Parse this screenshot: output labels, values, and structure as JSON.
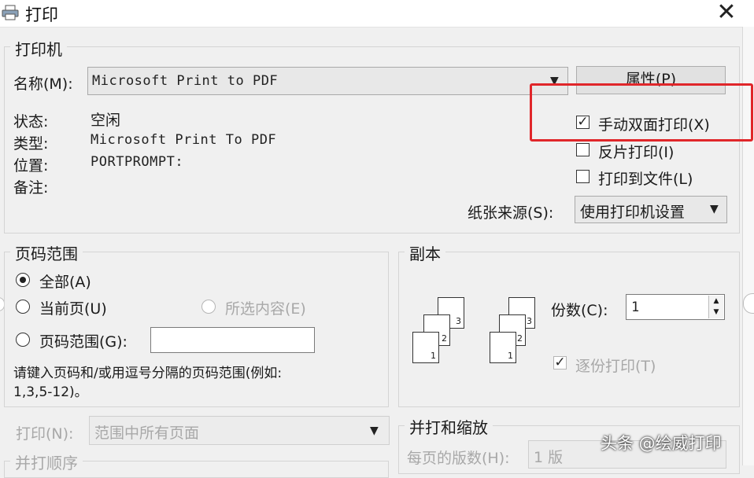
{
  "window": {
    "title": "打印",
    "close_glyph": "✕"
  },
  "printer": {
    "group_label": "打印机",
    "name_label": "名称(M):",
    "name_value": "Microsoft Print to PDF",
    "properties_button": "属性(P)",
    "status_label": "状态:",
    "status_value": "空闲",
    "type_label": "类型:",
    "type_value": "Microsoft Print To PDF",
    "location_label": "位置:",
    "location_value": "PORTPROMPT:",
    "comment_label": "备注:",
    "manual_duplex": {
      "label": "手动双面打印(X)",
      "checked": true
    },
    "reverse_print": {
      "label": "反片打印(I)",
      "checked": false
    },
    "print_to_file": {
      "label": "打印到文件(L)",
      "checked": false
    },
    "paper_source_label": "纸张来源(S):",
    "paper_source_value": "使用打印机设置"
  },
  "page_range": {
    "group_label": "页码范围",
    "all": {
      "label": "全部(A)",
      "selected": true
    },
    "current": {
      "label": "当前页(U)",
      "selected": false
    },
    "selection": {
      "label": "所选内容(E)",
      "selected": false,
      "enabled": false
    },
    "pages": {
      "label": "页码范围(G):",
      "selected": false,
      "value": ""
    },
    "hint_line1": "请键入页码和/或用逗号分隔的页码范围(例如:",
    "hint_line2": "1,3,5-12)。"
  },
  "copies": {
    "group_label": "副本",
    "count_label": "份数(C):",
    "count_value": "1",
    "collate": {
      "label": "逐份打印(T)",
      "checked": true,
      "enabled": false
    },
    "page_numbers": [
      "1",
      "2",
      "3"
    ]
  },
  "print_what": {
    "label": "打印(N):",
    "value": "范围中所有页面"
  },
  "print_order": {
    "label": "并打顺序"
  },
  "zoom": {
    "group_label": "并打和缩放",
    "pages_per_sheet_label": "每页的版数(H):",
    "pages_per_sheet_value": "1 版"
  },
  "watermark": "头条 @绘威打印",
  "colors": {
    "highlight": "#e0262a",
    "dialog_bg": "#f0f0f0",
    "disabled_text": "#a8a8a8"
  }
}
